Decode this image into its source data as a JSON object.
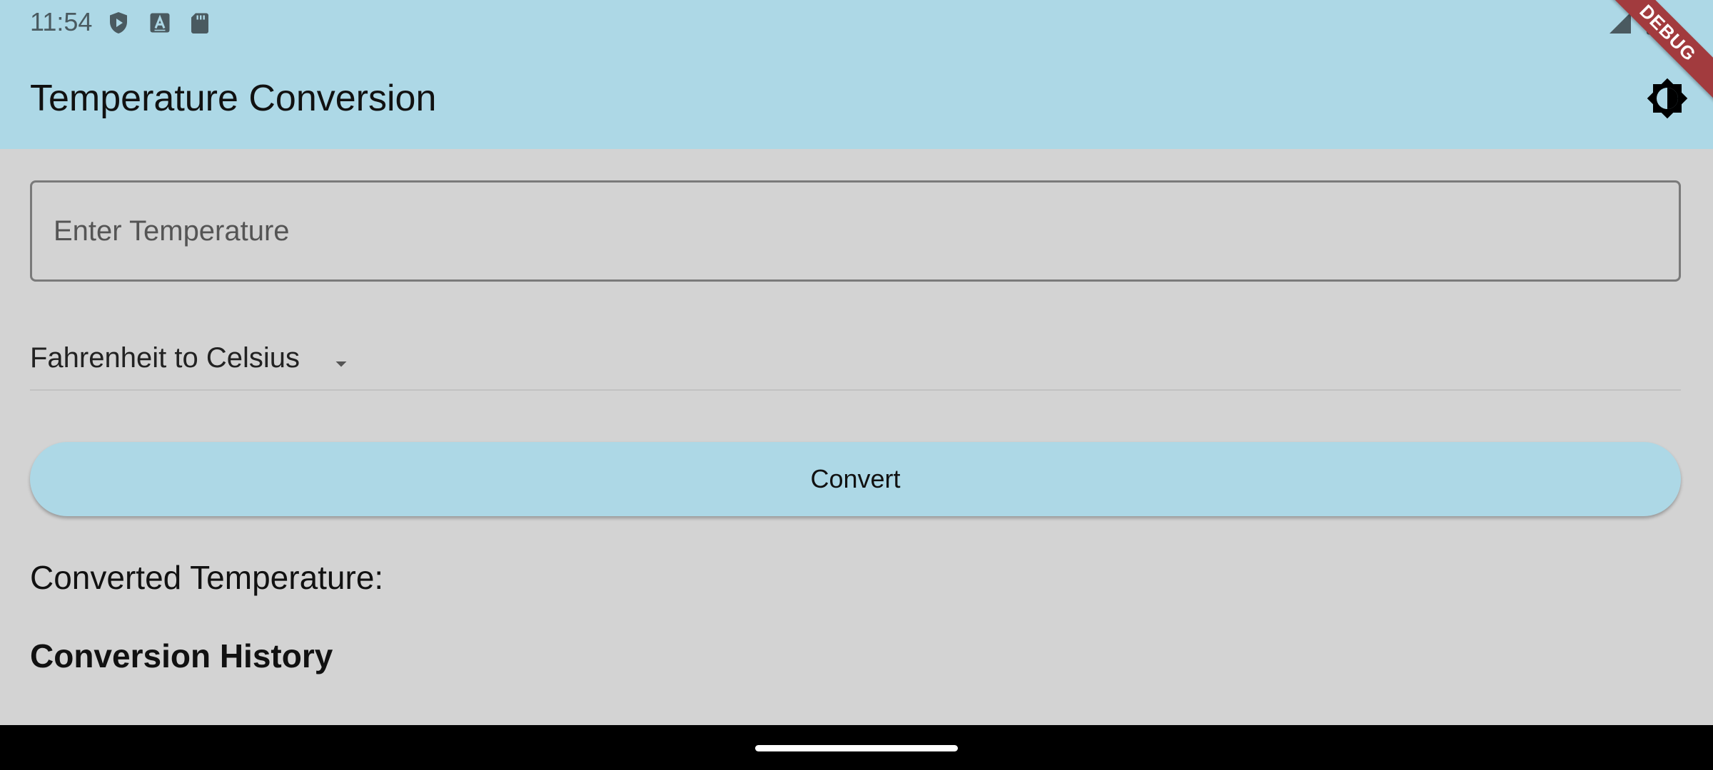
{
  "status_bar": {
    "time": "11:54",
    "left_icons": [
      "shield-play-icon",
      "font-a-icon",
      "sd-card-icon"
    ],
    "right_icons": [
      "cell-signal-icon",
      "battery-icon"
    ]
  },
  "app_bar": {
    "title": "Temperature Conversion",
    "theme_toggle_icon": "brightness-icon",
    "debug_banner": "DEBUG"
  },
  "form": {
    "temperature_input": {
      "value": "",
      "placeholder": "Enter Temperature"
    },
    "conversion_dropdown": {
      "selected": "Fahrenheit to Celsius"
    },
    "convert_button_label": "Convert"
  },
  "result": {
    "converted_label": "Converted Temperature:"
  },
  "history": {
    "heading": "Conversion History",
    "items": []
  },
  "colors": {
    "primary": "#add8e6",
    "background": "#d3d3d3",
    "debug_ribbon": "#a23b3e"
  }
}
